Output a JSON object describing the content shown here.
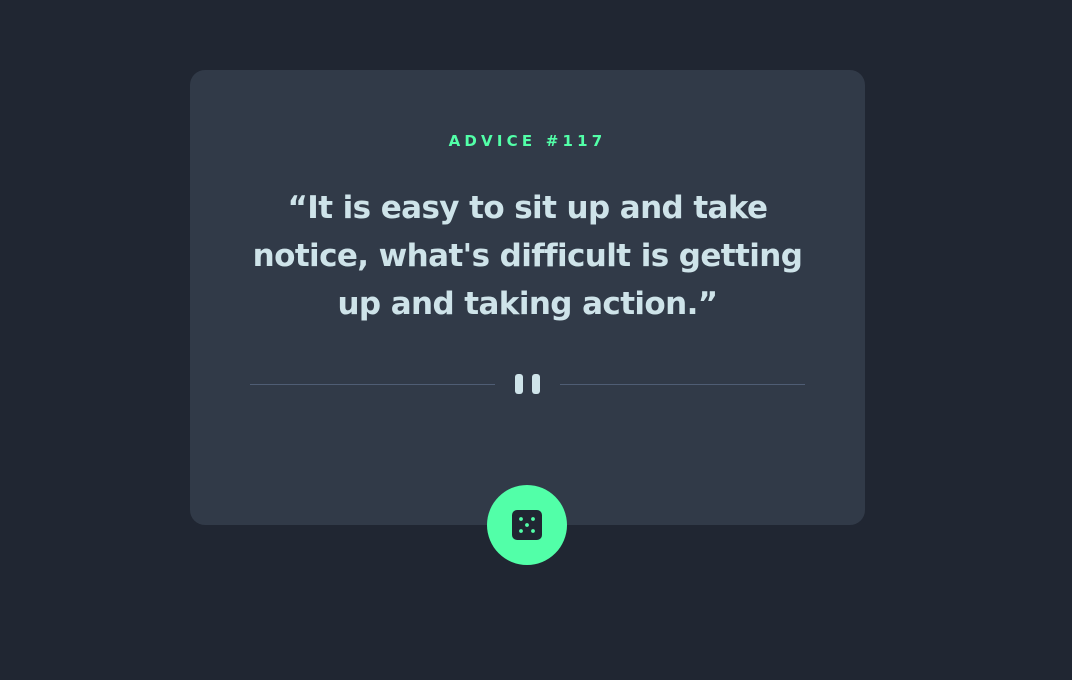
{
  "advice": {
    "id_label": "ADVICE #117",
    "quote": "“It is easy to sit up and take notice, what's difficult is getting up and taking action.”"
  },
  "divider": {
    "icon": "pause-icon"
  },
  "button": {
    "icon": "dice-icon"
  },
  "colors": {
    "background": "#202632",
    "card": "#313a48",
    "accent": "#52ffa8",
    "text": "#cee3e9",
    "divider_line": "#4f5d74"
  }
}
